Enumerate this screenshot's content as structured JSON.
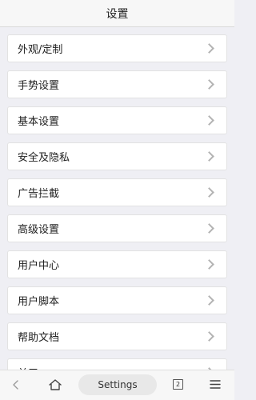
{
  "header": {
    "title": "设置"
  },
  "menu": {
    "items": [
      {
        "label": "外观/定制"
      },
      {
        "label": "手势设置"
      },
      {
        "label": "基本设置"
      },
      {
        "label": "安全及隐私"
      },
      {
        "label": "广告拦截"
      },
      {
        "label": "高级设置"
      },
      {
        "label": "用户中心"
      },
      {
        "label": "用户脚本"
      },
      {
        "label": "帮助文档"
      },
      {
        "label": "关于"
      }
    ]
  },
  "bottombar": {
    "url_text": "Settings",
    "tab_count": "2",
    "icons": [
      "back-icon",
      "home-icon",
      "tabs-icon",
      "menu-icon"
    ]
  },
  "colors": {
    "background": "#efeff4",
    "card": "#ffffff",
    "chevron": "#b3b3b3"
  }
}
